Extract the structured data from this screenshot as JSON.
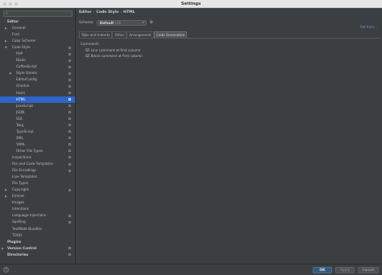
{
  "window": {
    "title": "Settings"
  },
  "sidebar": {
    "search_icon": "search-icon",
    "items": [
      {
        "label": "Editor",
        "indent": 0,
        "arrow": "",
        "bold": true,
        "config": false,
        "selected": false
      },
      {
        "label": "General",
        "indent": 1,
        "arrow": "▶",
        "bold": false,
        "config": false,
        "selected": false
      },
      {
        "label": "Font",
        "indent": 1,
        "arrow": "",
        "bold": false,
        "config": false,
        "selected": false
      },
      {
        "label": "Color Scheme",
        "indent": 1,
        "arrow": "▶",
        "bold": false,
        "config": false,
        "selected": false
      },
      {
        "label": "Code Style",
        "indent": 1,
        "arrow": "▼",
        "bold": false,
        "config": true,
        "selected": false
      },
      {
        "label": "PHP",
        "indent": 2,
        "arrow": "",
        "bold": false,
        "config": true,
        "selected": false
      },
      {
        "label": "Blade",
        "indent": 2,
        "arrow": "",
        "bold": false,
        "config": true,
        "selected": false
      },
      {
        "label": "CoffeeScript",
        "indent": 2,
        "arrow": "",
        "bold": false,
        "config": true,
        "selected": false
      },
      {
        "label": "Style Sheets",
        "indent": 2,
        "arrow": "▶",
        "bold": false,
        "config": true,
        "selected": false
      },
      {
        "label": "EditorConfig",
        "indent": 2,
        "arrow": "",
        "bold": false,
        "config": true,
        "selected": false
      },
      {
        "label": "Gherkin",
        "indent": 2,
        "arrow": "",
        "bold": false,
        "config": true,
        "selected": false
      },
      {
        "label": "Haml",
        "indent": 2,
        "arrow": "",
        "bold": false,
        "config": true,
        "selected": false
      },
      {
        "label": "HTML",
        "indent": 2,
        "arrow": "",
        "bold": false,
        "config": true,
        "selected": true
      },
      {
        "label": "JavaScript",
        "indent": 2,
        "arrow": "",
        "bold": false,
        "config": true,
        "selected": false
      },
      {
        "label": "JSON",
        "indent": 2,
        "arrow": "",
        "bold": false,
        "config": true,
        "selected": false
      },
      {
        "label": "SQL",
        "indent": 2,
        "arrow": "",
        "bold": false,
        "config": true,
        "selected": false
      },
      {
        "label": "Twig",
        "indent": 2,
        "arrow": "",
        "bold": false,
        "config": true,
        "selected": false
      },
      {
        "label": "TypeScript",
        "indent": 2,
        "arrow": "",
        "bold": false,
        "config": true,
        "selected": false
      },
      {
        "label": "XML",
        "indent": 2,
        "arrow": "",
        "bold": false,
        "config": true,
        "selected": false
      },
      {
        "label": "YAML",
        "indent": 2,
        "arrow": "",
        "bold": false,
        "config": true,
        "selected": false
      },
      {
        "label": "Other File Types",
        "indent": 2,
        "arrow": "",
        "bold": false,
        "config": true,
        "selected": false
      },
      {
        "label": "Inspections",
        "indent": 1,
        "arrow": "",
        "bold": false,
        "config": true,
        "selected": false
      },
      {
        "label": "File and Code Templates",
        "indent": 1,
        "arrow": "",
        "bold": false,
        "config": true,
        "selected": false
      },
      {
        "label": "File Encodings",
        "indent": 1,
        "arrow": "",
        "bold": false,
        "config": true,
        "selected": false
      },
      {
        "label": "Live Templates",
        "indent": 1,
        "arrow": "",
        "bold": false,
        "config": false,
        "selected": false
      },
      {
        "label": "File Types",
        "indent": 1,
        "arrow": "",
        "bold": false,
        "config": false,
        "selected": false
      },
      {
        "label": "Copyright",
        "indent": 1,
        "arrow": "▶",
        "bold": false,
        "config": true,
        "selected": false
      },
      {
        "label": "Emmet",
        "indent": 1,
        "arrow": "▶",
        "bold": false,
        "config": false,
        "selected": false
      },
      {
        "label": "Images",
        "indent": 1,
        "arrow": "",
        "bold": false,
        "config": false,
        "selected": false
      },
      {
        "label": "Intentions",
        "indent": 1,
        "arrow": "",
        "bold": false,
        "config": false,
        "selected": false
      },
      {
        "label": "Language Injections",
        "indent": 1,
        "arrow": "",
        "bold": false,
        "config": true,
        "selected": false
      },
      {
        "label": "Spelling",
        "indent": 1,
        "arrow": "",
        "bold": false,
        "config": true,
        "selected": false
      },
      {
        "label": "TextMate Bundles",
        "indent": 1,
        "arrow": "",
        "bold": false,
        "config": false,
        "selected": false
      },
      {
        "label": "TODO",
        "indent": 1,
        "arrow": "",
        "bold": false,
        "config": false,
        "selected": false
      },
      {
        "label": "Plugins",
        "indent": 0,
        "arrow": "",
        "bold": true,
        "config": false,
        "selected": false
      },
      {
        "label": "Version Control",
        "indent": 0,
        "arrow": "▶",
        "bold": true,
        "config": true,
        "selected": false
      },
      {
        "label": "Directories",
        "indent": 0,
        "arrow": "",
        "bold": true,
        "config": true,
        "selected": false
      }
    ]
  },
  "breadcrumb": {
    "part1": "Editor",
    "part2": "Code Style",
    "part3": "HTML",
    "sep": "›"
  },
  "scheme": {
    "label": "Scheme:",
    "name": "Default",
    "scope": "IDE",
    "dropdown_icon": "chevron-down-icon",
    "gear_icon": "gear-icon"
  },
  "reset_link": "Set from...",
  "tabs": [
    {
      "label": "Tabs and Indents",
      "active": false
    },
    {
      "label": "Other",
      "active": false
    },
    {
      "label": "Arrangement",
      "active": false
    },
    {
      "label": "Code Generation",
      "active": true
    }
  ],
  "comments": {
    "title": "Comments",
    "options": [
      {
        "label": "Line comment at first column",
        "checked": true
      },
      {
        "label": "Block comment at first column",
        "checked": true
      }
    ]
  },
  "footer": {
    "help": "?",
    "ok": "OK",
    "apply": "Apply",
    "cancel": "Cancel"
  }
}
